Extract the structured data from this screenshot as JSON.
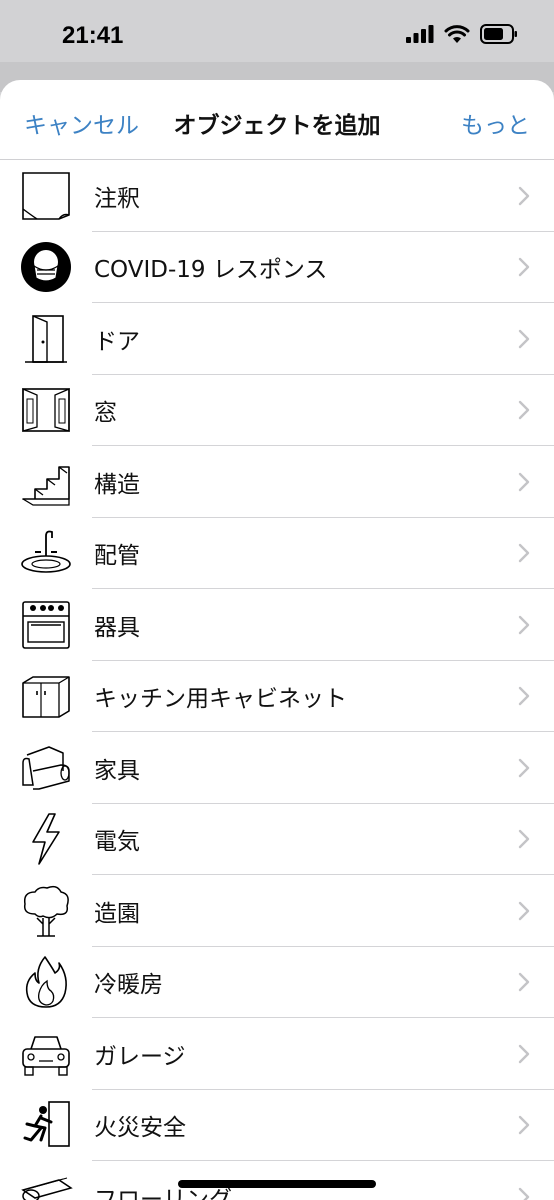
{
  "status_bar": {
    "time": "21:41"
  },
  "nav": {
    "cancel_label": "キャンセル",
    "title": "オブジェクトを追加",
    "more_label": "もっと"
  },
  "items": [
    {
      "label": "注釈",
      "icon": "note-icon"
    },
    {
      "label": "COVID-19 レスポンス",
      "icon": "face-mask-icon"
    },
    {
      "label": "ドア",
      "icon": "door-icon"
    },
    {
      "label": "窓",
      "icon": "window-icon"
    },
    {
      "label": "構造",
      "icon": "stairs-icon"
    },
    {
      "label": "配管",
      "icon": "sink-icon"
    },
    {
      "label": "器具",
      "icon": "stove-icon"
    },
    {
      "label": "キッチン用キャビネット",
      "icon": "cabinet-icon"
    },
    {
      "label": "家具",
      "icon": "sofa-icon"
    },
    {
      "label": "電気",
      "icon": "lightning-icon"
    },
    {
      "label": "造園",
      "icon": "tree-icon"
    },
    {
      "label": "冷暖房",
      "icon": "flame-icon"
    },
    {
      "label": "ガレージ",
      "icon": "car-icon"
    },
    {
      "label": "火災安全",
      "icon": "emergency-exit-icon"
    },
    {
      "label": "フローリング",
      "icon": "floor-roll-icon"
    }
  ],
  "colors": {
    "accent": "#3d82c4",
    "background": "#d2d2d4",
    "sheet": "#ffffff"
  }
}
